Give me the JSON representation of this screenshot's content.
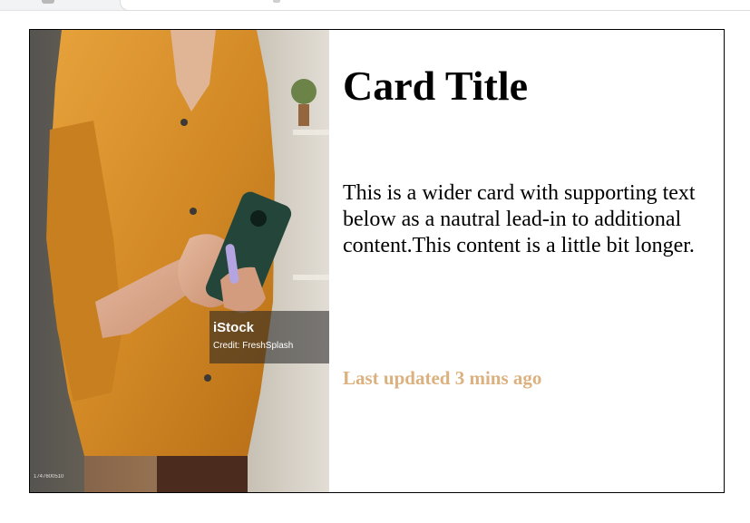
{
  "card": {
    "image": {
      "watermark_brand": "iStock",
      "watermark_credit": "Credit: FreshSplash",
      "corner_id": "1747600510"
    },
    "title": "Card Title",
    "text": "This is a wider card with supporting text below as a nautral lead-in to additional content.This content is a little bit longer.",
    "updated": "Last updated 3 mins ago"
  },
  "colors": {
    "updated_text": "#dbb27f",
    "shirt": "#d8922c",
    "phone": "#28493a"
  }
}
